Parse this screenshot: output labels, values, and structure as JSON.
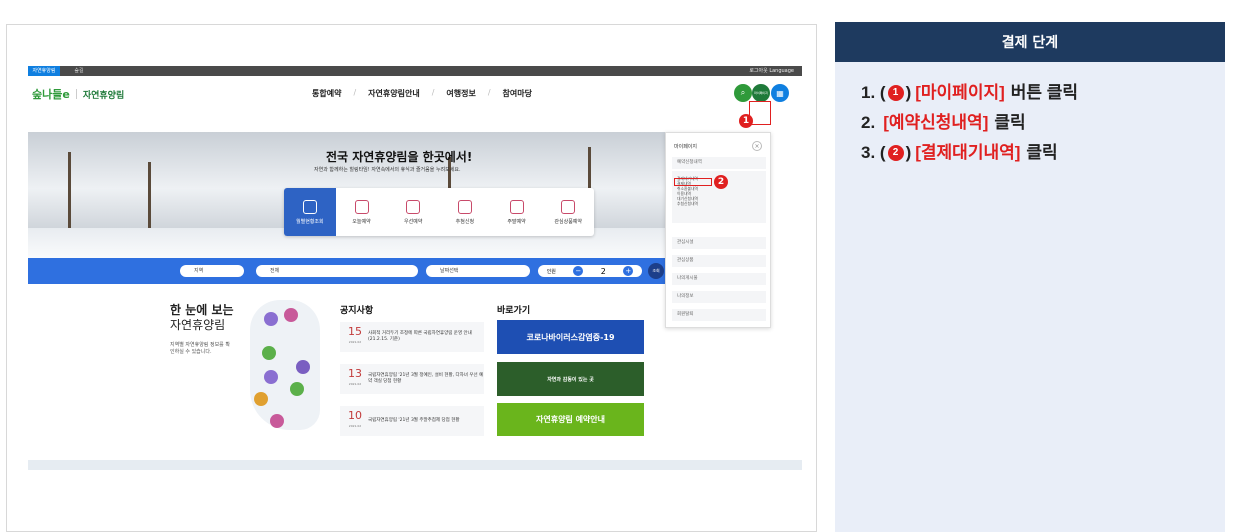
{
  "screenshot": {
    "topbar": {
      "tab_active": "자연휴양림",
      "tab_second": "숲길",
      "right_text": "로그아웃  Language"
    },
    "logo": {
      "mark": "숲나들e",
      "name": "자연휴양림"
    },
    "nav": [
      "통합예약",
      "자연휴양림안내",
      "여행정보",
      "참여마당"
    ],
    "header_icons": {
      "mypage_label": "마이페이지"
    },
    "hero": {
      "title": "전국 자연휴양림을 한곳에서!",
      "subtitle": "자연과 함께하는 힐링타임! 자연속에서의 휴식과 즐거움을 누려보세요.",
      "quick_menu": [
        "월별현황조회",
        "오늘예약",
        "우선예약",
        "추첨신청",
        "주말예약",
        "관심상품예약"
      ]
    },
    "search": {
      "region": "지역",
      "all": "전체",
      "date": "날짜선택",
      "people_label": "인원",
      "people_count": "2",
      "submit": "조회"
    },
    "overview": {
      "title_line1": "한 눈에 보는",
      "title_line2": "자연휴양림",
      "desc": "지역별 자연휴양림 정보를 확인하실 수 있습니다."
    },
    "notices": {
      "title": "공지사항",
      "items": [
        {
          "day": "15",
          "date": "2021.02",
          "text": "사회적 거리두기 조정에 따른 국립자연휴양림 운영 안내(21.2.15. 기준)"
        },
        {
          "day": "13",
          "date": "2021.02",
          "text": "국립자연휴양림 '21년 3월 정예인, 설비 현황, 다자녀 우선 예약 객실 당첨 현황"
        },
        {
          "day": "10",
          "date": "2021.02",
          "text": "국립자연휴양림 '21년 3월 주말추첨제 당첨 현황"
        }
      ]
    },
    "shortcuts": {
      "title": "바로가기",
      "banner1": "코로나바이러스감염증-19",
      "banner2": "자연과 감동이 있는 곳",
      "banner3": "자연휴양림 예약안내"
    },
    "dropdown": {
      "header": "마이페이지",
      "section": "예약신청내역",
      "sub_items": [
        "결제대기내역",
        "결제내역",
        "취소환불내역",
        "이용내역",
        "대기신청내역",
        "추첨신청내역"
      ],
      "other_items": [
        "관심시설",
        "관심상품",
        "나의게시물",
        "나의정보",
        "회원탈퇴"
      ]
    },
    "markers": {
      "m1": "1",
      "m2": "2"
    }
  },
  "panel": {
    "title": "결제 단계",
    "steps": [
      {
        "prefix": "1. (",
        "num": "1",
        "close": ")",
        "highlight": "[마이페이지]",
        "rest": "버튼 클릭"
      },
      {
        "prefix": "2.",
        "highlight": "[예약신청내역]",
        "rest": "클릭"
      },
      {
        "prefix": "3. (",
        "num": "2",
        "close": ")",
        "highlight": "[결제대기내역]",
        "rest": "클릭"
      }
    ]
  },
  "colors": {
    "panel_header": "#1e3a5f",
    "panel_bg": "#e9eef8",
    "accent_red": "#e02020",
    "brand_green": "#2f9a3a",
    "search_blue": "#2f70e0"
  }
}
